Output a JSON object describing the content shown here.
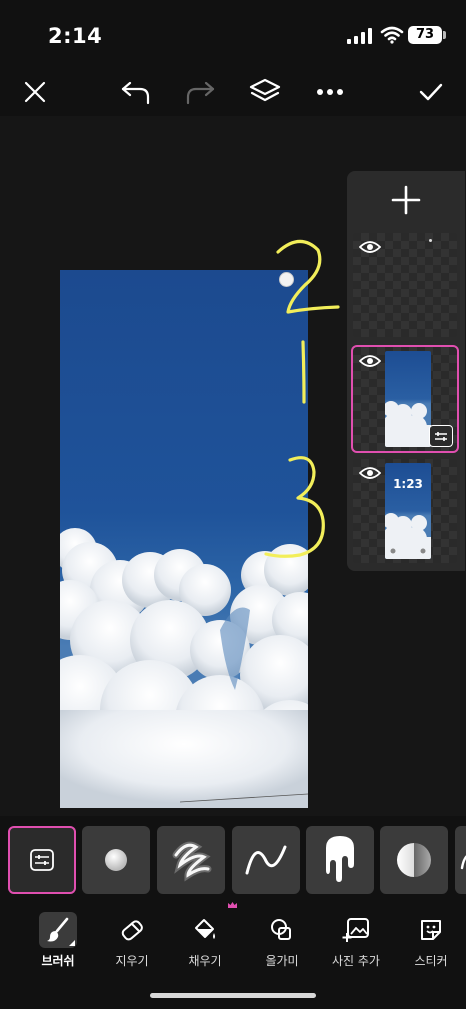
{
  "status": {
    "time": "2:14",
    "battery": "73"
  },
  "toolbar": {
    "close": "close-icon",
    "undo": "undo-icon",
    "redo": "redo-icon",
    "layers": "layers-icon",
    "more": "more-icon",
    "confirm": "check-icon"
  },
  "canvas": {
    "annotations": [
      "2",
      "1",
      "3"
    ]
  },
  "layers_panel": {
    "add": "plus-icon",
    "layers": [
      {
        "visible": true,
        "kind": "empty"
      },
      {
        "visible": true,
        "kind": "image",
        "selected": true
      },
      {
        "visible": true,
        "kind": "lockscreen",
        "lock_time": "1:23"
      }
    ]
  },
  "brushes": [
    "adjust-icon",
    "dot-brush",
    "glow-scribble-brush",
    "wave-brush",
    "drip-brush",
    "gradient-sphere-brush",
    "partial-brush"
  ],
  "bottom_nav": [
    {
      "label": "브러쉬",
      "icon": "brush-icon",
      "active": true
    },
    {
      "label": "지우기",
      "icon": "eraser-icon"
    },
    {
      "label": "채우기",
      "icon": "fill-bucket-icon",
      "premium": true
    },
    {
      "label": "올가미",
      "icon": "lasso-icon"
    },
    {
      "label": "사진 추가",
      "icon": "add-photo-icon"
    },
    {
      "label": "스티커",
      "icon": "sticker-icon"
    }
  ],
  "colors": {
    "accent": "#e04fb0",
    "annotation": "#f2ee5a",
    "sky": "#1f539a"
  }
}
